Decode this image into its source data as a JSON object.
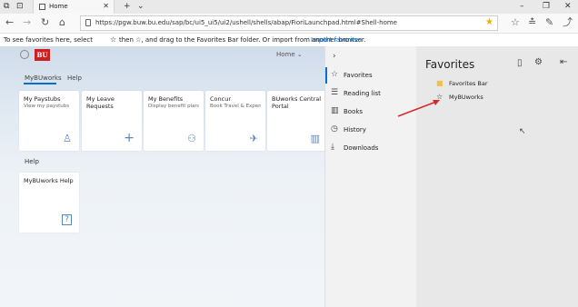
{
  "browser": {
    "tab_title": "Home",
    "url": "https://pgw.buw.bu.edu/sap/bc/ui5_ui5/ui2/ushell/shells/abap/FioriLaunchpad.html#Shell-home",
    "hint": {
      "text_before": "To see favorites here, select",
      "text_middle": "then ☆, and drag to the Favorites Bar folder. Or import from another browser.",
      "import_link": "Import favorites"
    },
    "colors": {
      "accent": "#0a6ed1",
      "favorite_star": "#e8b400",
      "logo_red": "#cc1f1f"
    }
  },
  "app": {
    "logo_text": "BU",
    "home_menu": "Home",
    "tabs": [
      "MyBUworks",
      "Help"
    ],
    "tiles": [
      {
        "title": "My Paystubs",
        "subtitle": "View my paystubs",
        "icon": "person-money-icon"
      },
      {
        "title": "My Leave Requests",
        "subtitle": "",
        "icon": "plus-icon"
      },
      {
        "title": "My Benefits",
        "subtitle": "Display benefit plans",
        "icon": "people-icon"
      },
      {
        "title": "Concur",
        "subtitle": "Book Travel & Expen...",
        "icon": "travel-icon"
      },
      {
        "title": "BUworks Central Portal",
        "subtitle": "",
        "icon": "building-icon"
      }
    ],
    "help_section": "Help",
    "help_tile": {
      "title": "MyBUworks Help",
      "icon": "help-icon"
    }
  },
  "hub": {
    "items": [
      {
        "label": "Favorites",
        "icon": "star-icon"
      },
      {
        "label": "Reading list",
        "icon": "reading-list-icon"
      },
      {
        "label": "Books",
        "icon": "books-icon"
      },
      {
        "label": "History",
        "icon": "history-icon"
      },
      {
        "label": "Downloads",
        "icon": "download-icon"
      }
    ]
  },
  "favorites": {
    "title": "Favorites",
    "entries": [
      {
        "label": "Favorites Bar",
        "icon": "folder-icon"
      },
      {
        "label": "MyBUworks",
        "icon": "star-outline-icon"
      }
    ]
  }
}
